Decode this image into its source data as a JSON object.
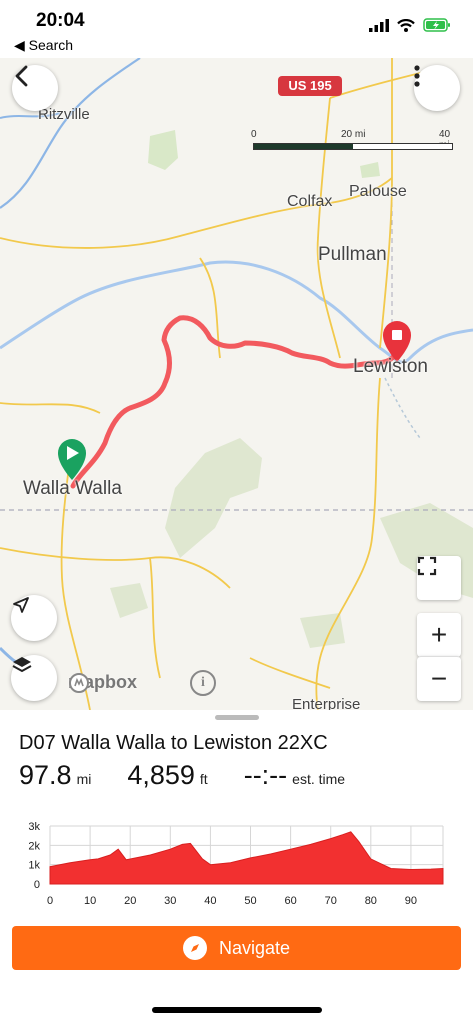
{
  "status_bar": {
    "time": "20:04",
    "back_label": "◀ Search"
  },
  "map": {
    "highway_shield": "US 195",
    "scale": {
      "labels": [
        "0",
        "20 mi",
        "40 mi"
      ]
    },
    "places": {
      "ritzville": "Ritzville",
      "colfax": "Colfax",
      "palouse": "Palouse",
      "pullman": "Pullman",
      "lewiston": "Lewiston",
      "walla_walla": "Walla Walla",
      "enterprise": "Enterprise"
    },
    "attribution": "mapbox",
    "info_glyph": "i",
    "zoom_in_glyph": "+",
    "zoom_out_glyph": "−",
    "colors": {
      "route": "#f25a5e",
      "start": "#1aa260",
      "end": "#e8333c"
    }
  },
  "route": {
    "name": "D07 Walla Walla to Lewiston 22XC",
    "distance": "97.8",
    "distance_unit": "mi",
    "elevation_gain": "4,859",
    "elevation_unit": "ft",
    "est_time": "--:--",
    "est_time_label": "est. time"
  },
  "chart_data": {
    "type": "area",
    "x": [
      0,
      5,
      10,
      12,
      15,
      17,
      19,
      25,
      30,
      33,
      35,
      38,
      40,
      45,
      50,
      55,
      60,
      65,
      70,
      73,
      75,
      77,
      80,
      85,
      90,
      95,
      98
    ],
    "y": [
      900,
      1100,
      1250,
      1300,
      1500,
      1800,
      1250,
      1500,
      1800,
      2050,
      2100,
      1300,
      1000,
      1100,
      1350,
      1550,
      1800,
      2050,
      2350,
      2550,
      2700,
      2200,
      1300,
      800,
      750,
      770,
      800
    ],
    "xlim": [
      0,
      98
    ],
    "ylim": [
      0,
      3000
    ],
    "x_ticks": [
      "0",
      "10",
      "20",
      "30",
      "40",
      "50",
      "60",
      "70",
      "80",
      "90"
    ],
    "y_ticks": [
      "3k",
      "2k",
      "1k",
      "0"
    ],
    "grid": true,
    "fill_color": "#f23030"
  },
  "navigate": {
    "label": "Navigate"
  }
}
